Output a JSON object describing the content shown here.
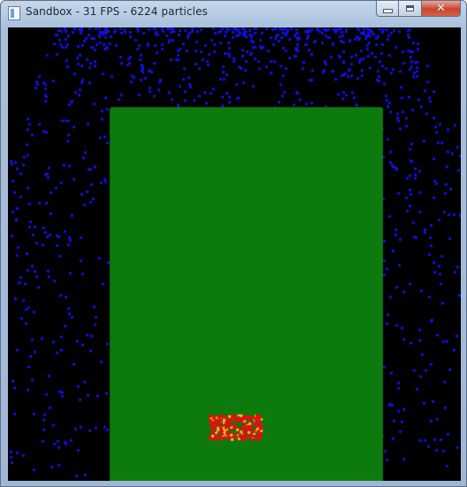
{
  "window": {
    "title": "Sandbox - 31 FPS - 6224 particles"
  },
  "simulation": {
    "background_color": "#000000",
    "particle_colors": {
      "water": "#1010e0",
      "plant": "#0c7a0c",
      "fire": "#e01010",
      "spark": "#f0c020"
    }
  }
}
